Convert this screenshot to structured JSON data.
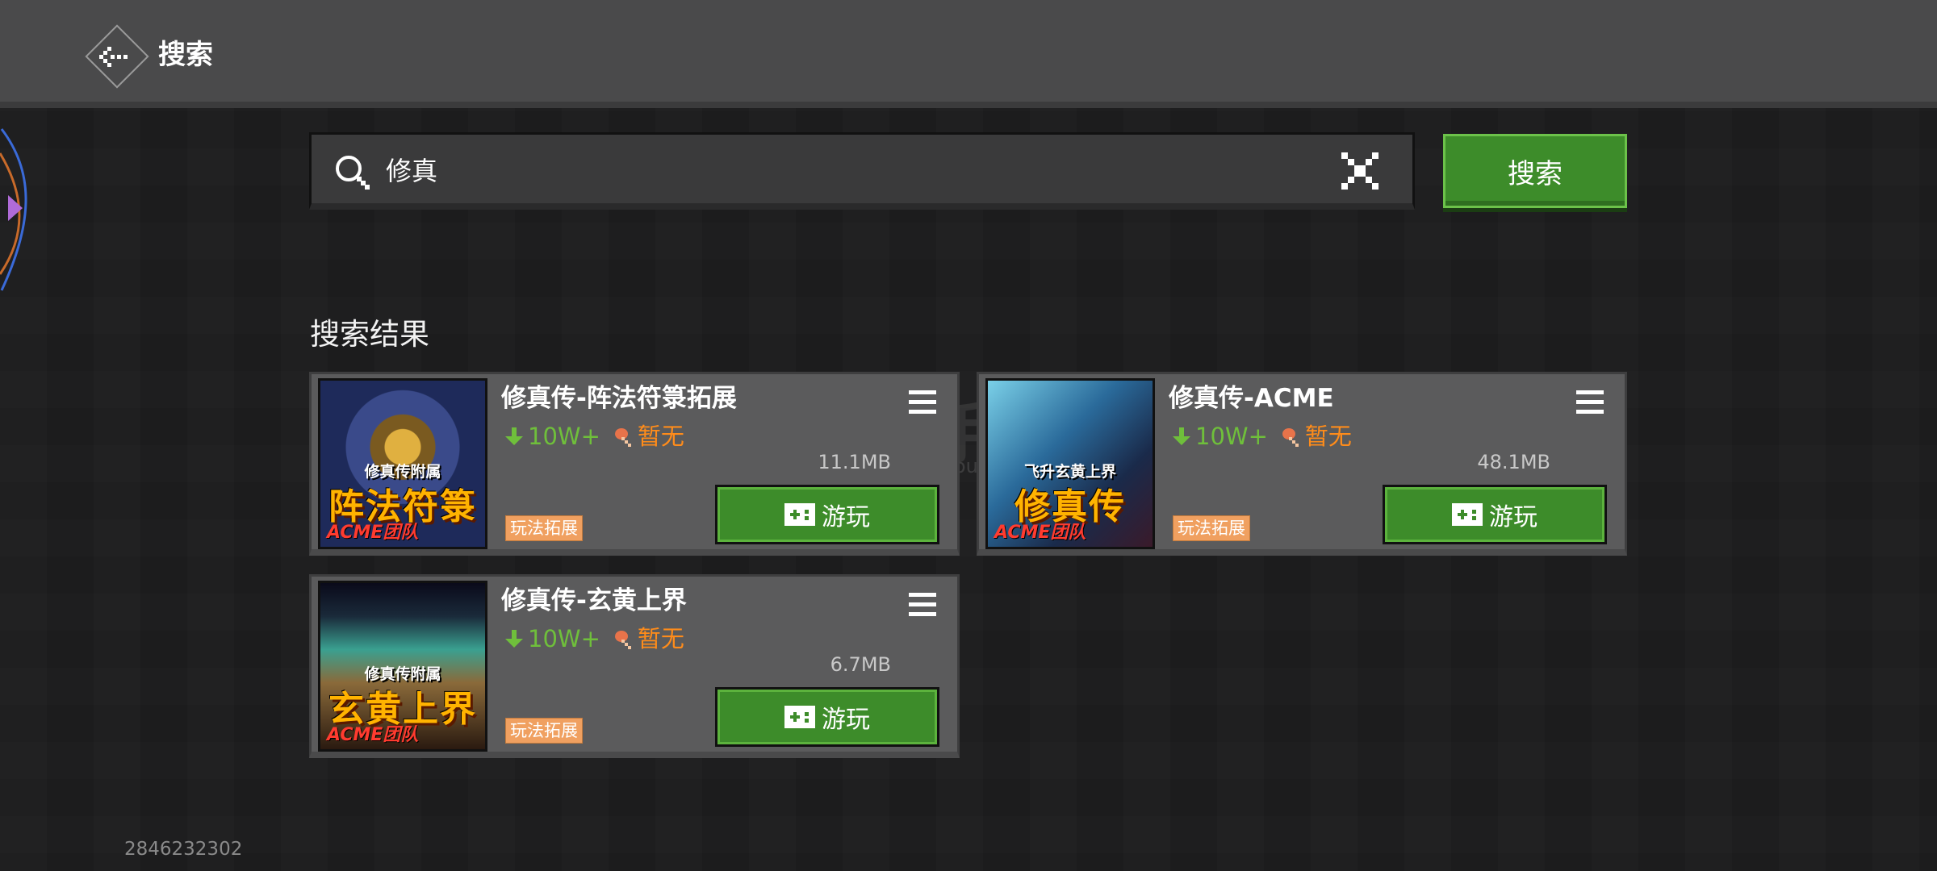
{
  "header": {
    "title": "搜索"
  },
  "search": {
    "query": "修真",
    "button_label": "搜索"
  },
  "results": {
    "title": "搜索结果",
    "items": [
      {
        "title": "修真传-阵法符箓拓展",
        "downloads": "10W+",
        "rating": "暂无",
        "size": "11.1MB",
        "tag": "玩法拓展",
        "play_label": "游玩",
        "thumb_small": "修真传附属",
        "thumb_big": "阵法符箓",
        "thumb_team": "ACME团队"
      },
      {
        "title": "修真传-ACME",
        "downloads": "10W+",
        "rating": "暂无",
        "size": "48.1MB",
        "tag": "玩法拓展",
        "play_label": "游玩",
        "thumb_small": "飞升玄黄上界",
        "thumb_big": "修真传",
        "thumb_team": "ACME团队"
      },
      {
        "title": "修真传-玄黄上界",
        "downloads": "10W+",
        "rating": "暂无",
        "size": "6.7MB",
        "tag": "玩法拓展",
        "play_label": "游玩",
        "thumb_small": "修真传附属",
        "thumb_big": "玄黄上界",
        "thumb_team": "ACME团队"
      }
    ]
  },
  "watermark": {
    "main": "淘手游",
    "sub": "Taoshouyou"
  },
  "footer": {
    "user_id": "2846232302"
  },
  "colors": {
    "accent_green": "#3d8c2a",
    "download_green": "#6fbf3b",
    "rating_orange": "#ff8c1a",
    "tag_orange": "#f0a060"
  },
  "icons": [
    "back-arrow-icon",
    "search-icon",
    "clear-icon",
    "menu-icon",
    "download-arrow-icon",
    "rating-icon",
    "gamepad-icon"
  ]
}
